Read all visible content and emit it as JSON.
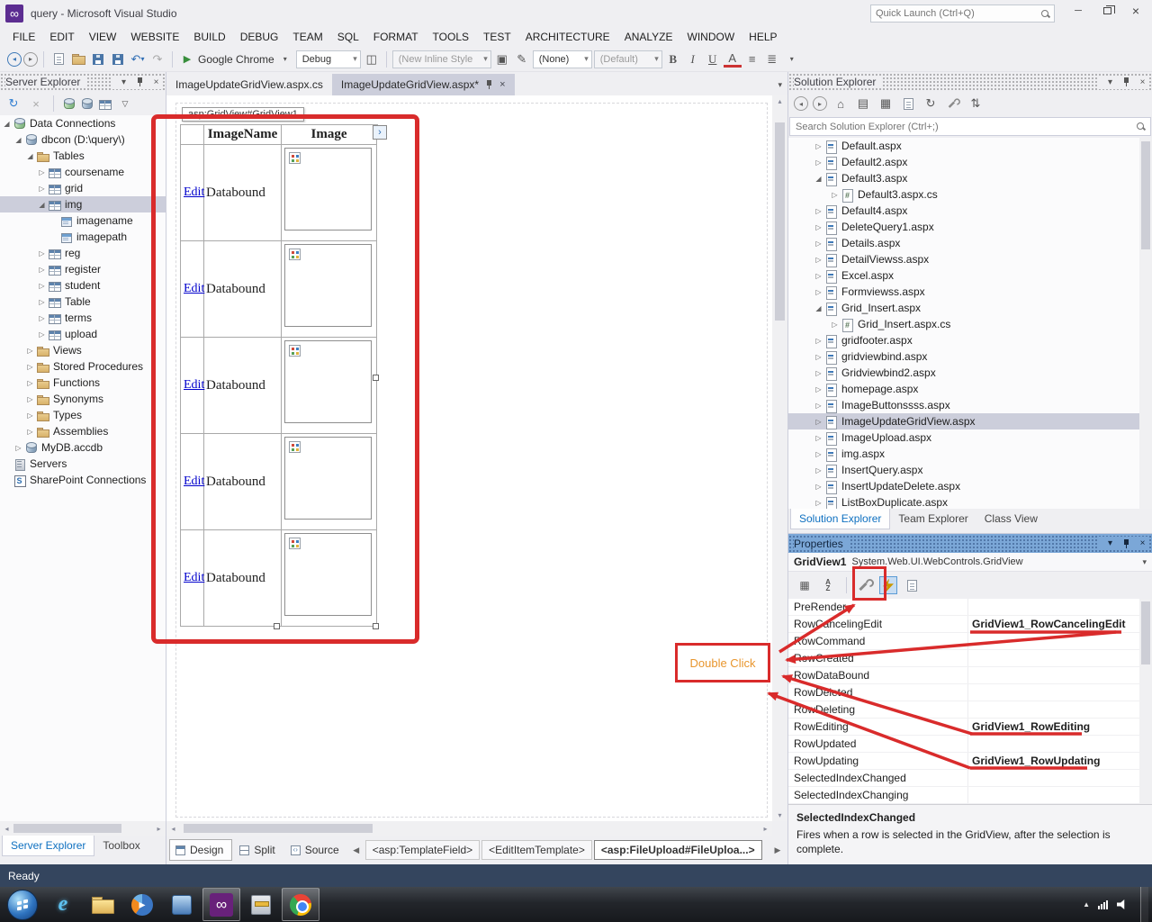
{
  "colors": {
    "annotation_red": "#D92B2B",
    "double_click_text": "#E8962E",
    "selection_highlight": "#CCCEDB",
    "active_tab_unfocused": "#CCCEDB",
    "properties_header_blue": "#7BA7D7",
    "status_bar_bg": "#34455E"
  },
  "window": {
    "title": "query - Microsoft Visual Studio",
    "quick_launch_placeholder": "Quick Launch (Ctrl+Q)"
  },
  "menu": {
    "items": [
      {
        "label": "FILE"
      },
      {
        "label": "EDIT"
      },
      {
        "label": "VIEW"
      },
      {
        "label": "WEBSITE"
      },
      {
        "label": "BUILD"
      },
      {
        "label": "DEBUG"
      },
      {
        "label": "TEAM"
      },
      {
        "label": "SQL"
      },
      {
        "label": "FORMAT"
      },
      {
        "label": "TOOLS"
      },
      {
        "label": "TEST"
      },
      {
        "label": "ARCHITECTURE"
      },
      {
        "label": "ANALYZE"
      },
      {
        "label": "WINDOW"
      },
      {
        "label": "HELP"
      }
    ]
  },
  "toolbar": {
    "run_browser": "Google Chrome",
    "solution_config": "Debug",
    "style_dropdown": "(New Inline Style",
    "target_rule_dropdown": "(None)",
    "format_dropdown": "(Default)",
    "bold": "B",
    "italic": "I",
    "underline": "U"
  },
  "server_explorer": {
    "title": "Server Explorer",
    "tree": [
      {
        "label": "Data Connections",
        "depth": 0,
        "icon": "connections",
        "arrow": "expanded"
      },
      {
        "label": "dbcon (D:\\query\\)",
        "depth": 1,
        "icon": "database",
        "arrow": "expanded"
      },
      {
        "label": "Tables",
        "depth": 2,
        "icon": "folder",
        "arrow": "expanded"
      },
      {
        "label": "coursename",
        "depth": 3,
        "icon": "table",
        "arrow": "collapsed"
      },
      {
        "label": "grid",
        "depth": 3,
        "icon": "table",
        "arrow": "collapsed"
      },
      {
        "label": "img",
        "depth": 3,
        "icon": "table",
        "arrow": "expanded",
        "selected": true
      },
      {
        "label": "imagename",
        "depth": 4,
        "icon": "column"
      },
      {
        "label": "imagepath",
        "depth": 4,
        "icon": "column"
      },
      {
        "label": "reg",
        "depth": 3,
        "icon": "table",
        "arrow": "collapsed"
      },
      {
        "label": "register",
        "depth": 3,
        "icon": "table",
        "arrow": "collapsed"
      },
      {
        "label": "student",
        "depth": 3,
        "icon": "table",
        "arrow": "collapsed"
      },
      {
        "label": "Table",
        "depth": 3,
        "icon": "table",
        "arrow": "collapsed"
      },
      {
        "label": "terms",
        "depth": 3,
        "icon": "table",
        "arrow": "collapsed"
      },
      {
        "label": "upload",
        "depth": 3,
        "icon": "table",
        "arrow": "collapsed"
      },
      {
        "label": "Views",
        "depth": 2,
        "icon": "folder",
        "arrow": "collapsed"
      },
      {
        "label": "Stored Procedures",
        "depth": 2,
        "icon": "folder",
        "arrow": "collapsed"
      },
      {
        "label": "Functions",
        "depth": 2,
        "icon": "folder",
        "arrow": "collapsed"
      },
      {
        "label": "Synonyms",
        "depth": 2,
        "icon": "folder",
        "arrow": "collapsed"
      },
      {
        "label": "Types",
        "depth": 2,
        "icon": "folder",
        "arrow": "collapsed"
      },
      {
        "label": "Assemblies",
        "depth": 2,
        "icon": "folder",
        "arrow": "collapsed"
      },
      {
        "label": "MyDB.accdb",
        "depth": 1,
        "icon": "database",
        "arrow": "collapsed"
      },
      {
        "label": "Servers",
        "depth": 0,
        "icon": "server"
      },
      {
        "label": "SharePoint Connections",
        "depth": 0,
        "icon": "sharepoint"
      }
    ],
    "tabs": [
      {
        "label": "Server Explorer",
        "active": true
      },
      {
        "label": "Toolbox"
      }
    ]
  },
  "editor": {
    "code_tab_label": "ImageUpdateGridView.aspx.cs",
    "design_tab_label": "ImageUpdateGridView.aspx*",
    "control_tag": "asp:GridView#GridView1",
    "grid": {
      "headers": [
        {
          "label": "ImageName"
        },
        {
          "label": "Image"
        }
      ],
      "rows": [
        {
          "edit": "Edit",
          "name": "Databound"
        },
        {
          "edit": "Edit",
          "name": "Databound"
        },
        {
          "edit": "Edit",
          "name": "Databound"
        },
        {
          "edit": "Edit",
          "name": "Databound"
        },
        {
          "edit": "Edit",
          "name": "Databound"
        }
      ]
    },
    "view_buttons": [
      {
        "label": "Design",
        "active": true,
        "icon_kind": "design"
      },
      {
        "label": "Split",
        "icon_kind": "split"
      },
      {
        "label": "Source",
        "icon_kind": "source"
      }
    ],
    "tag_path": [
      {
        "label": "<asp:TemplateField>"
      },
      {
        "label": "<EditItemTemplate>"
      },
      {
        "label": "<asp:FileUpload#FileUploa...>",
        "active": true
      }
    ]
  },
  "solution_explorer": {
    "title": "Solution Explorer",
    "search_placeholder": "Search Solution Explorer (Ctrl+;)",
    "tree": [
      {
        "label": "Default.aspx",
        "depth": 0,
        "icon": "aspx",
        "arrow": "collapsed"
      },
      {
        "label": "Default2.aspx",
        "depth": 0,
        "icon": "aspx",
        "arrow": "collapsed"
      },
      {
        "label": "Default3.aspx",
        "depth": 0,
        "icon": "aspx",
        "arrow": "expanded"
      },
      {
        "label": "Default3.aspx.cs",
        "depth": 1,
        "icon": "cs",
        "arrow": "collapsed"
      },
      {
        "label": "Default4.aspx",
        "depth": 0,
        "icon": "aspx",
        "arrow": "collapsed"
      },
      {
        "label": "DeleteQuery1.aspx",
        "depth": 0,
        "icon": "aspx",
        "arrow": "collapsed"
      },
      {
        "label": "Details.aspx",
        "depth": 0,
        "icon": "aspx",
        "arrow": "collapsed"
      },
      {
        "label": "DetailViewss.aspx",
        "depth": 0,
        "icon": "aspx",
        "arrow": "collapsed"
      },
      {
        "label": "Excel.aspx",
        "depth": 0,
        "icon": "aspx",
        "arrow": "collapsed"
      },
      {
        "label": "Formviewss.aspx",
        "depth": 0,
        "icon": "aspx",
        "arrow": "collapsed"
      },
      {
        "label": "Grid_Insert.aspx",
        "depth": 0,
        "icon": "aspx",
        "arrow": "expanded"
      },
      {
        "label": "Grid_Insert.aspx.cs",
        "depth": 1,
        "icon": "cs",
        "arrow": "collapsed"
      },
      {
        "label": "gridfooter.aspx",
        "depth": 0,
        "icon": "aspx",
        "arrow": "collapsed"
      },
      {
        "label": "gridviewbind.aspx",
        "depth": 0,
        "icon": "aspx",
        "arrow": "collapsed"
      },
      {
        "label": "Gridviewbind2.aspx",
        "depth": 0,
        "icon": "aspx",
        "arrow": "collapsed"
      },
      {
        "label": "homepage.aspx",
        "depth": 0,
        "icon": "aspx",
        "arrow": "collapsed"
      },
      {
        "label": "ImageButtonssss.aspx",
        "depth": 0,
        "icon": "aspx",
        "arrow": "collapsed"
      },
      {
        "label": "ImageUpdateGridView.aspx",
        "depth": 0,
        "icon": "aspx",
        "arrow": "collapsed",
        "selected": true
      },
      {
        "label": "ImageUpload.aspx",
        "depth": 0,
        "icon": "aspx",
        "arrow": "collapsed"
      },
      {
        "label": "img.aspx",
        "depth": 0,
        "icon": "aspx",
        "arrow": "collapsed"
      },
      {
        "label": "InsertQuery.aspx",
        "depth": 0,
        "icon": "aspx",
        "arrow": "collapsed"
      },
      {
        "label": "InsertUpdateDelete.aspx",
        "depth": 0,
        "icon": "aspx",
        "arrow": "collapsed"
      },
      {
        "label": "ListBoxDuplicate.aspx",
        "depth": 0,
        "icon": "aspx",
        "arrow": "collapsed"
      }
    ],
    "tabs": [
      {
        "label": "Solution Explorer",
        "active": true
      },
      {
        "label": "Team Explorer"
      },
      {
        "label": "Class View"
      }
    ]
  },
  "properties": {
    "title": "Properties",
    "object_name": "GridView1",
    "object_type": "System.Web.UI.WebControls.GridView",
    "toolbar_icons": [
      "categorized-icon",
      "alphabetical-icon",
      "properties-wrench-icon",
      "events-lightning-icon",
      "property-pages-icon"
    ],
    "events": [
      {
        "name": "PreRender",
        "value": ""
      },
      {
        "name": "RowCancelingEdit",
        "value": "GridView1_RowCancelingEdit"
      },
      {
        "name": "RowCommand",
        "value": ""
      },
      {
        "name": "RowCreated",
        "value": ""
      },
      {
        "name": "RowDataBound",
        "value": ""
      },
      {
        "name": "RowDeleted",
        "value": ""
      },
      {
        "name": "RowDeleting",
        "value": ""
      },
      {
        "name": "RowEditing",
        "value": "GridView1_RowEditing"
      },
      {
        "name": "RowUpdated",
        "value": ""
      },
      {
        "name": "RowUpdating",
        "value": "GridView1_RowUpdating"
      },
      {
        "name": "SelectedIndexChanged",
        "value": ""
      },
      {
        "name": "SelectedIndexChanging",
        "value": ""
      }
    ],
    "description_title": "SelectedIndexChanged",
    "description_text": "Fires when a row is selected in the GridView, after the selection is complete."
  },
  "annotations": {
    "double_click_label": "Double Click"
  },
  "status_bar": {
    "text": "Ready"
  },
  "taskbar": {
    "start_icon": "windows-start-orb",
    "icons": [
      {
        "icon": "ie"
      },
      {
        "icon": "folder"
      },
      {
        "icon": "wmp"
      },
      {
        "icon": "app"
      },
      {
        "icon": "vs",
        "active": true
      },
      {
        "icon": "tool"
      },
      {
        "icon": "chrome",
        "active": true
      }
    ]
  }
}
